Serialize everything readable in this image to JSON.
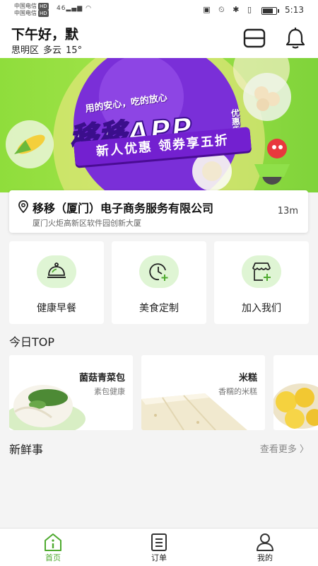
{
  "status_bar": {
    "carrier_1": "中国电信",
    "carrier_2": "中国电信",
    "hd": "HD",
    "network": "46",
    "time": "5:13",
    "battery_level": 0.7
  },
  "header": {
    "greeting": "下午好，默",
    "district": "思明区",
    "weather": "多云",
    "temperature": "15°"
  },
  "banner": {
    "slogan": "用的安心，吃的放心",
    "title": "移移APP",
    "badge": "优惠季",
    "ribbon": "新人优惠  领券享五折"
  },
  "store": {
    "name": "移移（厦门）电子商务服务有限公司",
    "address": "厦门火炬高新区软件园创新大厦",
    "distance": "13m"
  },
  "services": [
    {
      "label": "健康早餐",
      "icon": "cloche-icon"
    },
    {
      "label": "美食定制",
      "icon": "clock-plus-icon"
    },
    {
      "label": "加入我们",
      "icon": "store-plus-icon"
    }
  ],
  "today_top": {
    "title": "今日TOP",
    "items": [
      {
        "name": "菌菇青菜包",
        "desc": "素包健康"
      },
      {
        "name": "米糕",
        "desc": "香糯的米糕"
      },
      {
        "name": "",
        "desc": ""
      }
    ]
  },
  "news": {
    "title": "新鲜事",
    "more": "查看更多"
  },
  "tabbar": {
    "home": "首页",
    "orders": "订单",
    "mine": "我的"
  },
  "colors": {
    "accent_green": "#4eaa2f",
    "banner_green": "#9ee246",
    "banner_purple": "#6a1fc8",
    "tile_circle": "#dff5d4"
  }
}
